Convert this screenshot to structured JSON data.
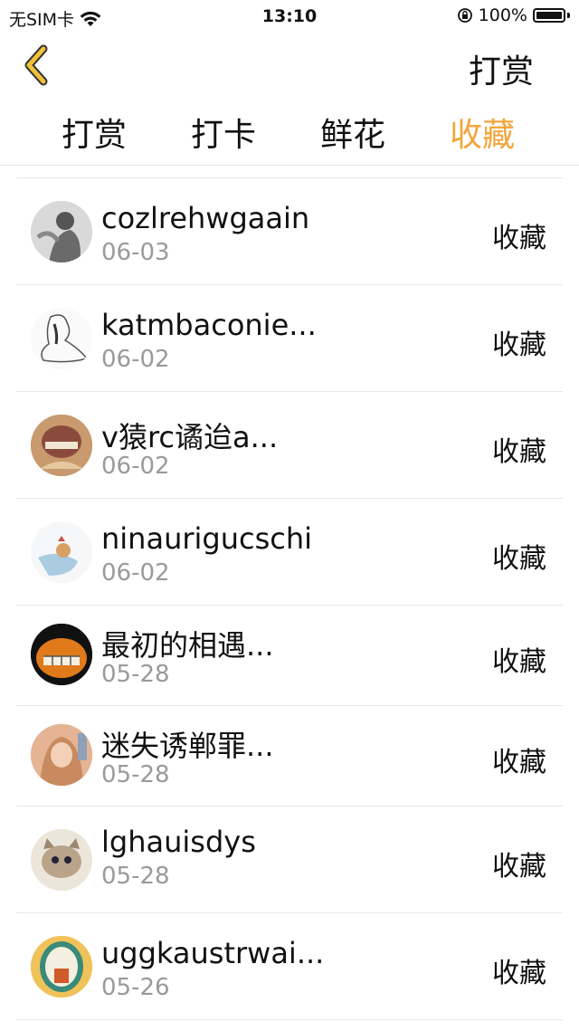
{
  "status": {
    "carrier": "无SIM卡",
    "time": "13:10",
    "battery": "100%"
  },
  "nav": {
    "title": "打赏"
  },
  "tabs": [
    {
      "label": "打赏",
      "active": false
    },
    {
      "label": "打卡",
      "active": false
    },
    {
      "label": "鲜花",
      "active": false
    },
    {
      "label": "收藏",
      "active": true
    }
  ],
  "accent_color": "#f2a53a",
  "list": [
    {
      "name": "cozlrehwgaain",
      "date": "06-03",
      "action": "收藏"
    },
    {
      "name": "katmbaconie...",
      "date": "06-02",
      "action": "收藏"
    },
    {
      "name": "v猿rc谲迨a...",
      "date": "06-02",
      "action": "收藏"
    },
    {
      "name": "ninaurigucschi",
      "date": "06-02",
      "action": "收藏"
    },
    {
      "name": "最初的相遇...",
      "date": "05-28",
      "action": "收藏"
    },
    {
      "name": "迷失诱郸罪...",
      "date": "05-28",
      "action": "收藏"
    },
    {
      "name": "lghauisdys",
      "date": "05-28",
      "action": "收藏"
    },
    {
      "name": "uggkaustrwai...",
      "date": "05-26",
      "action": "收藏"
    }
  ]
}
